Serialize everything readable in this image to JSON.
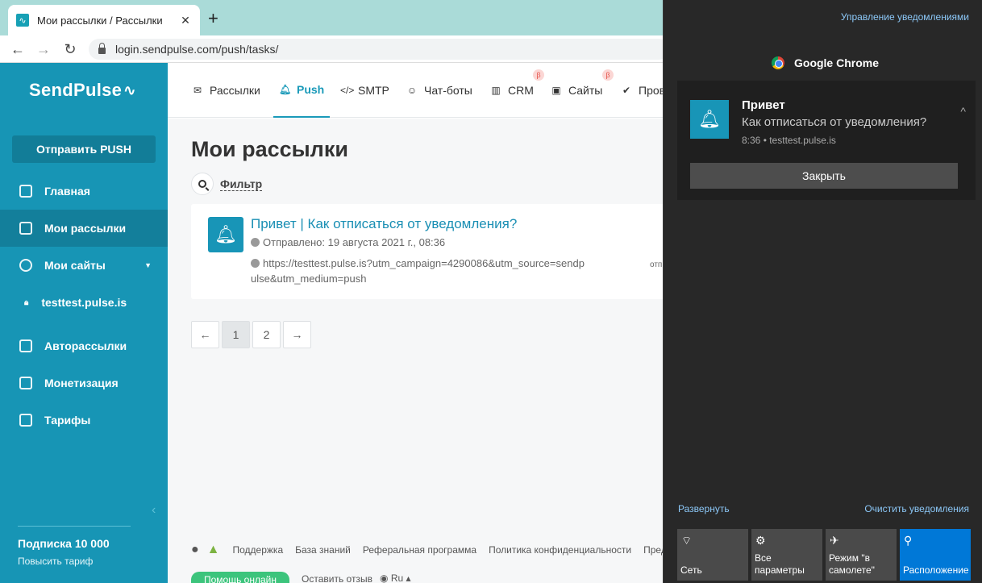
{
  "browser": {
    "tab_title": "Мои рассылки / Рассылки",
    "tab_close": "✕",
    "new_tab": "+",
    "url": "login.sendpulse.com/push/tasks/"
  },
  "sidebar": {
    "logo": "SendPulse",
    "logo_glyph": "∿",
    "send_button": "Отправить PUSH",
    "items": [
      {
        "label": "Главная",
        "icon": "dashboard-icon"
      },
      {
        "label": "Мои рассылки",
        "icon": "campaigns-icon",
        "active": true
      },
      {
        "label": "Мои сайты",
        "icon": "globe-icon",
        "caret": "▼"
      },
      {
        "label": "testtest.pulse.is",
        "icon": "lock-icon",
        "sub": true
      },
      {
        "label": "Авторассылки",
        "icon": "automation-icon"
      },
      {
        "label": "Монетизация",
        "icon": "monetization-icon"
      },
      {
        "label": "Тарифы",
        "icon": "wallet-icon"
      }
    ],
    "collapse": "‹",
    "subscription_title": "Подписка 10 000",
    "upgrade_link": "Повысить тариф"
  },
  "topnav": {
    "items": [
      {
        "label": "Рассылки",
        "icon": "mail-icon"
      },
      {
        "label": "Push",
        "icon": "bell-icon",
        "active": true
      },
      {
        "label": "SMTP",
        "icon": "code-icon"
      },
      {
        "label": "Чат-боты",
        "icon": "chat-icon"
      },
      {
        "label": "CRM",
        "icon": "crm-icon",
        "beta": "β"
      },
      {
        "label": "Сайты",
        "icon": "site-icon",
        "beta": "β"
      },
      {
        "label": "Прове",
        "icon": "check-icon"
      }
    ]
  },
  "main": {
    "title": "Мои рассылки",
    "filter": "Фильтр",
    "campaign": {
      "title": "Привет | Как отписаться от уведомления?",
      "sent": "Отправлено: 19 августа 2021 г., 08:36",
      "url": "https://testtest.pulse.is?utm_campaign=4290086&utm_source=sendpulse&utm_medium=push",
      "trailing": "отп"
    },
    "pagination": {
      "prev": "←",
      "pages": [
        "1",
        "2"
      ],
      "next": "→",
      "current": "1"
    }
  },
  "footer": {
    "links": [
      "Поддержка",
      "База знаний",
      "Реферальная программа",
      "Политика конфиденциальности",
      "Преда"
    ],
    "help": "Помощь онлайн",
    "feedback": "Оставить отзыв",
    "lang": "Ru ▴"
  },
  "action_center": {
    "manage": "Управление уведомлениями",
    "app_name": "Google Chrome",
    "notification": {
      "title": "Привет",
      "body": "Как отписаться от уведомления?",
      "meta": "8:36 • testtest.pulse.is",
      "close_button": "Закрыть",
      "chevron": "^"
    },
    "expand": "Развернуть",
    "clear": "Очистить уведомления",
    "tiles": [
      {
        "label": "Сеть",
        "icon": "network-icon",
        "glyph": "⌔"
      },
      {
        "label": "Все параметры",
        "icon": "settings-icon",
        "glyph": "⚙"
      },
      {
        "label": "Режим \"в самолете\"",
        "icon": "airplane-icon",
        "glyph": "✈"
      },
      {
        "label": "Расположение",
        "icon": "location-icon",
        "glyph": "⚲",
        "on": true
      }
    ]
  },
  "colors": {
    "brand": "#1795b5",
    "link": "#1a8fb4",
    "action_center_bg": "#282828",
    "accent_tile": "#0078d7"
  }
}
